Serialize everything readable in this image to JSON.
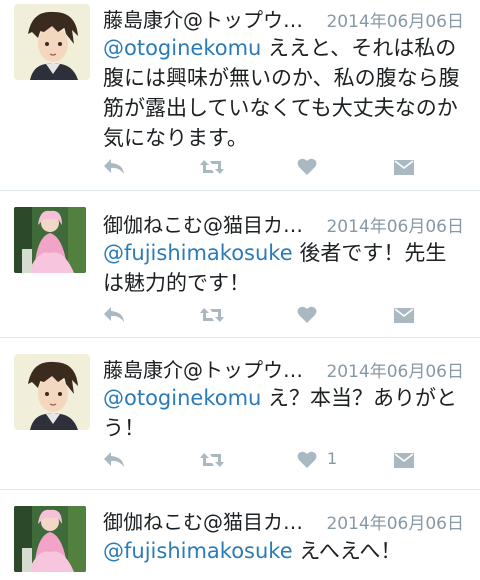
{
  "tweets": [
    {
      "author": "藤島康介@トップウ…",
      "date": "2014年06月06日",
      "mention": "@otoginekomu",
      "text": " ええと、それは私の腹には興味が無いのか、私の腹なら腹筋が露出していなくても大丈夫なのか気になります。",
      "like_count": ""
    },
    {
      "author": "御伽ねこむ@猫目カ…",
      "date": "2014年06月06日",
      "mention": "@fujishimakosuke",
      "text": " 後者です！先生は魅力的です！",
      "like_count": ""
    },
    {
      "author": "藤島康介@トップウ…",
      "date": "2014年06月06日",
      "mention": "@otoginekomu",
      "text": " え？本当？ありがとう！",
      "like_count": "1"
    },
    {
      "author": "御伽ねこむ@猫目カ…",
      "date": "2014年06月06日",
      "mention": "@fujishimakosuke",
      "text": " えへえへ！",
      "like_count": ""
    }
  ],
  "icons": [
    "reply-icon",
    "retweet-icon",
    "like-icon",
    "message-icon"
  ],
  "colors": {
    "mention": "#2b7bb9",
    "meta": "#8899a6",
    "icon": "#aab8c2",
    "divider": "#e1e8ed"
  }
}
